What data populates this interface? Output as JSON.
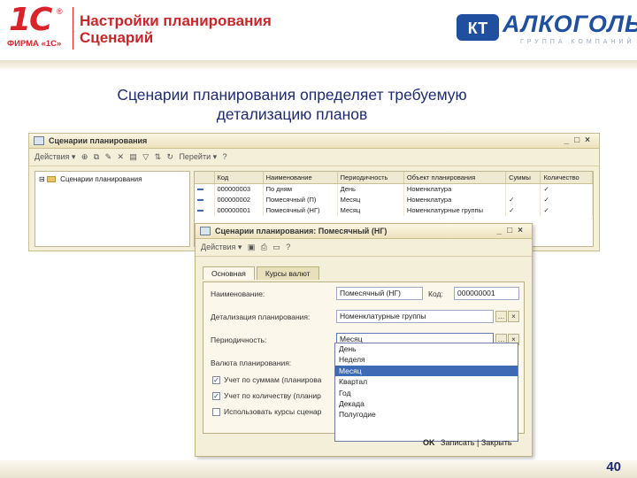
{
  "header": {
    "logo_1c": "1С",
    "logo_reg": "®",
    "firm": "ФИРМА «1С»",
    "title_line1": "Настройки планирования",
    "title_line2": "Сценарий",
    "partner_logo": "АЛКОГОЛЬ",
    "partner_tagline": "ГРУППА КОМПАНИЙ",
    "partner_mark": "КТ"
  },
  "subtitle": {
    "line1": "Сценарии планирования определяет требуемую",
    "line2": "детализацию планов"
  },
  "list_window": {
    "title": "Сценарии планирования",
    "toolbar": {
      "actions": "Действия ▾",
      "go": "Перейти ▾",
      "help": "?"
    },
    "tree_root": "Сценарии планирования",
    "columns": [
      "Код",
      "Наименование",
      "Периодичность",
      "Объект планирования",
      "Суммы",
      "Количество"
    ],
    "rows": [
      {
        "mark": "▬",
        "code": "000000003",
        "name": "По дням",
        "period": "День",
        "object": "Номенклатура",
        "sums": "",
        "qty": "✓"
      },
      {
        "mark": "▬",
        "code": "000000002",
        "name": "Помесячный (П)",
        "period": "Месяц",
        "object": "Номенклатура",
        "sums": "✓",
        "qty": "✓"
      },
      {
        "mark": "▬",
        "code": "000000001",
        "name": "Помесячный (НГ)",
        "period": "Месяц",
        "object": "Номенклатурные группы",
        "sums": "✓",
        "qty": "✓"
      }
    ]
  },
  "form_window": {
    "title": "Сценарии планирования: Помесячный (НГ)",
    "actions": "Действия ▾",
    "tabs": [
      "Основная",
      "Курсы валют"
    ],
    "fields": {
      "name_label": "Наименование:",
      "name_value": "Помесячный (НГ)",
      "code_label": "Код:",
      "code_value": "000000001",
      "detail_label": "Детализация планирования:",
      "detail_value": "Номенклатурные группы",
      "period_label": "Периодичность:",
      "period_value": "Месяц",
      "currency_label": "Валюта планирования:"
    },
    "checkboxes": [
      {
        "label": "Учет по суммам (планирова",
        "checked": "✓"
      },
      {
        "label": "Учет по количеству (планир",
        "checked": "✓"
      },
      {
        "label": "Использовать курсы сценар",
        "checked": ""
      }
    ],
    "dropdown_options": [
      "День",
      "Неделя",
      "Месяц",
      "Квартал",
      "Год",
      "Декада",
      "Полугодие"
    ],
    "dropdown_selected": "Месяц",
    "bottom_buttons": {
      "ok": "OK",
      "write": "Записать",
      "close": "Закрыть"
    }
  },
  "page_number": "40"
}
